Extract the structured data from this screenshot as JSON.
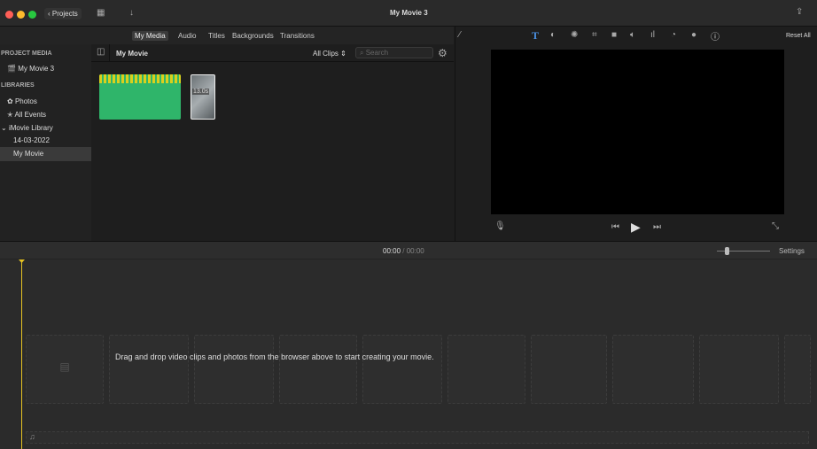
{
  "window": {
    "title": "My Movie 3",
    "projects_label": "Projects"
  },
  "tabs": [
    "My Media",
    "Audio",
    "Titles",
    "Backgrounds",
    "Transitions"
  ],
  "sidebar": {
    "project_media_heading": "PROJECT MEDIA",
    "project": "My Movie 3",
    "libraries_heading": "LIBRARIES",
    "items": [
      "Photos",
      "All Events",
      "iMovie Library",
      "14-03-2022",
      "My Movie"
    ]
  },
  "browser": {
    "title": "My Movie",
    "filter": "All Clips",
    "search_placeholder": "Search",
    "clip_duration": "13.0s"
  },
  "viewer": {
    "reset_label": "Reset All"
  },
  "timeline": {
    "current_time": "00:00",
    "separator": "/",
    "total_time": "00:00",
    "settings_label": "Settings",
    "hint": "Drag and drop video clips and photos from the browser above to start creating your movie."
  },
  "colors": {
    "accent": "#4a90e2",
    "playhead": "#e6c323",
    "clip_green": "#2fb56a"
  }
}
